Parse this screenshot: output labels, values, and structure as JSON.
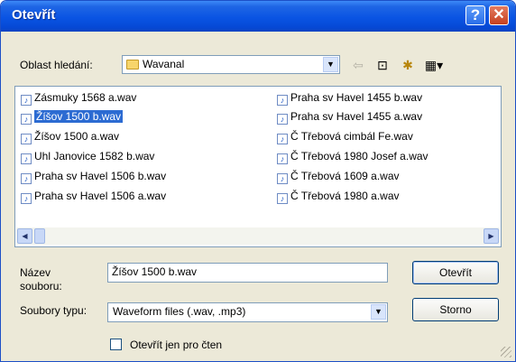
{
  "window": {
    "title": "Otevřít"
  },
  "titlebar": {
    "help_glyph": "?",
    "close_glyph": "✕"
  },
  "lookin": {
    "label": "Oblast hledání:",
    "value": "Wavanal"
  },
  "toolbar": {
    "back_glyph": "⇦",
    "up_glyph": "⊡",
    "newfolder_glyph": "✱",
    "views_glyph": "▦▾"
  },
  "files": {
    "col1": [
      "Zásmuky 1568 a.wav",
      "Žíšov 1500 b.wav",
      "Žíšov 1500 a.wav",
      "Uhl Janovice 1582 b.wav",
      "Praha sv Havel 1506 b.wav",
      "Praha sv Havel 1506 a.wav"
    ],
    "col2": [
      "Praha sv Havel 1455 b.wav",
      "Praha sv Havel 1455 a.wav",
      "Č Třebová cimbál Fe.wav",
      "Č Třebová 1980 Josef a.wav",
      "Č Třebová 1609 a.wav",
      "Č Třebová 1980 a.wav"
    ],
    "selected": "Žíšov 1500 b.wav",
    "icon_glyph": "♪"
  },
  "filename": {
    "label_line1": "Název",
    "label_line2": "souboru:",
    "value": "Žíšov 1500 b.wav"
  },
  "filetype": {
    "label": "Soubory typu:",
    "value": "Waveform files (.wav, .mp3)"
  },
  "buttons": {
    "open": "Otevřít",
    "cancel": "Storno"
  },
  "readonly": {
    "label": "Otevřít jen pro čten"
  },
  "colors": {
    "titlebar": "#0a54e3",
    "selection": "#2c6bd2",
    "dialog_bg": "#ece9d8",
    "close": "#c6401f"
  }
}
